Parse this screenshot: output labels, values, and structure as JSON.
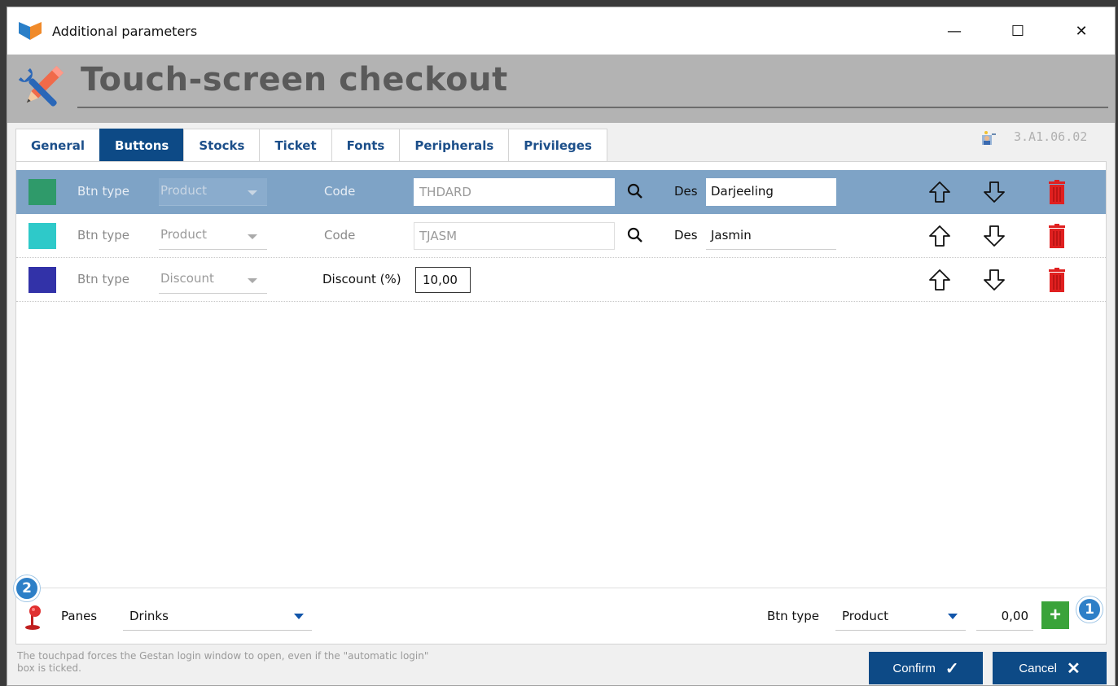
{
  "window": {
    "title": "Additional parameters",
    "controls": {
      "minimize": "—",
      "maximize": "☐",
      "close": "✕"
    }
  },
  "header": {
    "title": "Touch-screen checkout"
  },
  "tabs": [
    {
      "label": "General",
      "active": false
    },
    {
      "label": "Buttons",
      "active": true
    },
    {
      "label": "Stocks",
      "active": false
    },
    {
      "label": "Ticket",
      "active": false
    },
    {
      "label": "Fonts",
      "active": false
    },
    {
      "label": "Peripherals",
      "active": false
    },
    {
      "label": "Privileges",
      "active": false
    }
  ],
  "version": "3.A1.06.02",
  "rows": [
    {
      "color": "#2f9a6a",
      "type_label": "Btn type",
      "type_value": "Product",
      "code_label": "Code",
      "code_value": "THDARD",
      "des_label": "Des",
      "des_value": "Darjeeling",
      "selected": true
    },
    {
      "color": "#2ec9c9",
      "type_label": "Btn type",
      "type_value": "Product",
      "code_label": "Code",
      "code_value": "TJASM",
      "des_label": "Des",
      "des_value": "Jasmin",
      "selected": false
    },
    {
      "color": "#3232a8",
      "type_label": "Btn type",
      "type_value": "Discount",
      "discount_label": "Discount (%)",
      "discount_value": "10,00",
      "selected": false
    }
  ],
  "bottom": {
    "panes_label": "Panes",
    "panes_value": "Drinks",
    "btn_type_label": "Btn type",
    "btn_type_value": "Product",
    "amount": "0,00",
    "add_glyph": "+",
    "badge_1": "1",
    "badge_2": "2"
  },
  "footnote": "The touchpad forces the Gestan login window to open, even if the \"automatic login\" box is ticked.",
  "buttons": {
    "confirm_label": "Confirm",
    "confirm_glyph": "✓",
    "cancel_label": "Cancel",
    "cancel_glyph": "✕"
  },
  "colors": {
    "accent": "#0d4a86",
    "selected_row": "#7ea3c6",
    "add_green": "#3aa33a",
    "delete_red": "#e02020"
  }
}
